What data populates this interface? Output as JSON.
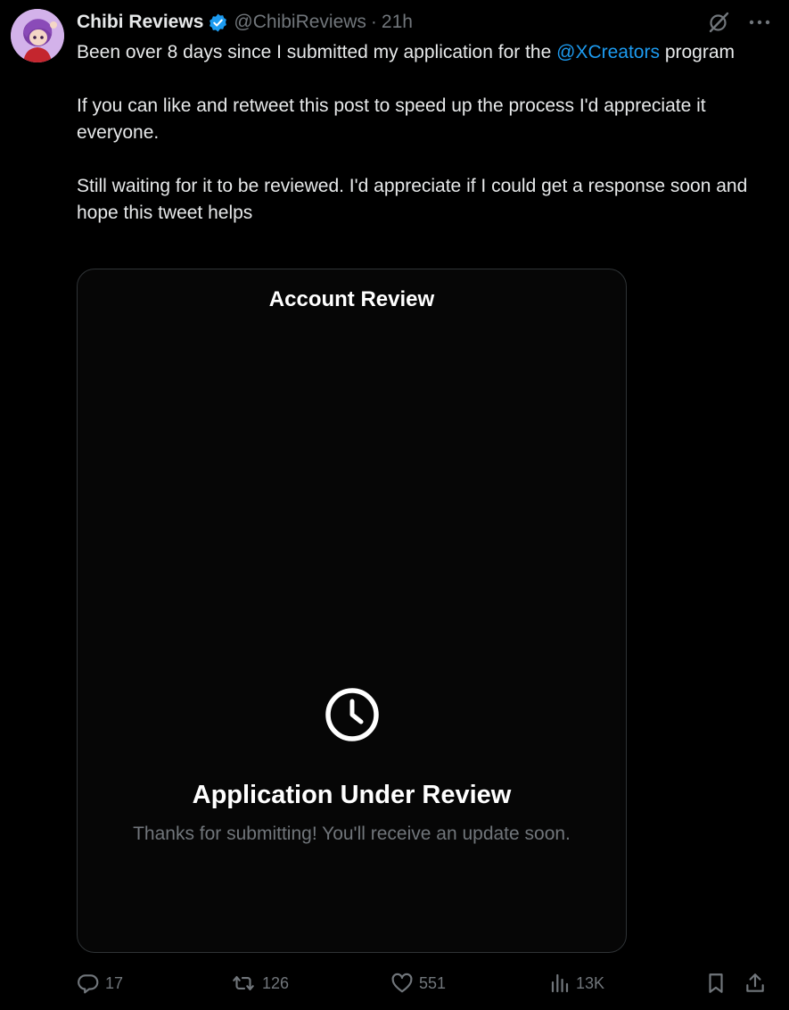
{
  "author": {
    "display_name": "Chibi Reviews",
    "handle": "@ChibiReviews",
    "separator": "·",
    "time": "21h",
    "verified": true
  },
  "post": {
    "line1_before": "Been over 8 days since I submitted my application for the ",
    "mention": "@XCreators",
    "line1_after": " program",
    "paragraph2": "If you can like and retweet this post to speed up the process I'd appreciate it everyone.",
    "paragraph3": "Still waiting for it to be reviewed. I'd appreciate if I could get a response soon and hope this tweet helps"
  },
  "media": {
    "title": "Account Review",
    "icon": "clock-icon",
    "heading": "Application Under Review",
    "subtext": "Thanks for submitting! You'll receive an update soon."
  },
  "actions": {
    "replies": "17",
    "reposts": "126",
    "likes": "551",
    "views": "13K"
  },
  "colors": {
    "background": "#000000",
    "text": "#e7e9ea",
    "muted": "#71767b",
    "accent": "#1d9bf0"
  }
}
